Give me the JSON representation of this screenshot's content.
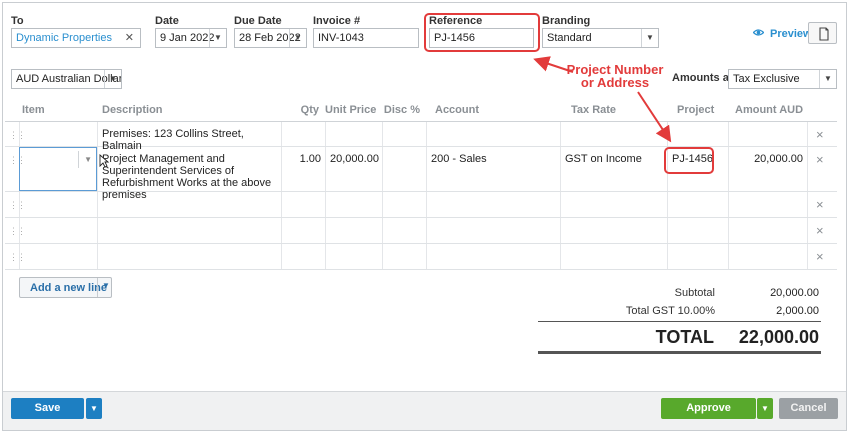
{
  "header": {
    "to": {
      "label": "To",
      "value": "Dynamic Properties",
      "clear_icon": "close-icon"
    },
    "date": {
      "label": "Date",
      "value": "9 Jan 2022"
    },
    "due_date": {
      "label": "Due Date",
      "value": "28 Feb 2022"
    },
    "invoice": {
      "label": "Invoice #",
      "value": "INV-1043"
    },
    "reference": {
      "label": "Reference",
      "value": "PJ-1456"
    },
    "branding": {
      "label": "Branding",
      "value": "Standard"
    },
    "preview_label": "Preview",
    "currency": "AUD Australian Dollar",
    "amounts_are_label": "Amounts are",
    "amounts_are_value": "Tax Exclusive"
  },
  "table": {
    "columns": [
      "Item",
      "Description",
      "Qty",
      "Unit Price",
      "Disc %",
      "Account",
      "Tax Rate",
      "Project",
      "Amount AUD"
    ],
    "rows": [
      {
        "item": "",
        "description": "Premises: 123 Collins Street, Balmain",
        "qty": "",
        "unit_price": "",
        "disc": "",
        "account": "",
        "tax_rate": "",
        "project": "",
        "amount": ""
      },
      {
        "item": "",
        "description": "Project Management and Superintendent Services of Refurbishment Works at the above premises",
        "qty": "1.00",
        "unit_price": "20,000.00",
        "disc": "",
        "account": "200 - Sales",
        "tax_rate": "GST on Income",
        "project": "PJ-1456",
        "amount": "20,000.00"
      },
      {
        "item": "",
        "description": "",
        "qty": "",
        "unit_price": "",
        "disc": "",
        "account": "",
        "tax_rate": "",
        "project": "",
        "amount": ""
      },
      {
        "item": "",
        "description": "",
        "qty": "",
        "unit_price": "",
        "disc": "",
        "account": "",
        "tax_rate": "",
        "project": "",
        "amount": ""
      },
      {
        "item": "",
        "description": "",
        "qty": "",
        "unit_price": "",
        "disc": "",
        "account": "",
        "tax_rate": "",
        "project": "",
        "amount": ""
      }
    ],
    "add_line_label": "Add a new line"
  },
  "totals": {
    "subtotal_label": "Subtotal",
    "subtotal_value": "20,000.00",
    "gst_label": "Total GST 10.00%",
    "gst_value": "2,000.00",
    "total_label": "TOTAL",
    "total_value": "22,000.00"
  },
  "footer": {
    "save_label": "Save",
    "approve_label": "Approve",
    "cancel_label": "Cancel"
  },
  "annotation": {
    "text_line1": "Project Number",
    "text_line2": "or Address"
  },
  "colors": {
    "accent": "#2a8fcf",
    "save": "#1d7fc2",
    "approve": "#58a92c",
    "cancel": "#9ba0a4",
    "annotation": "#e23b3b"
  }
}
